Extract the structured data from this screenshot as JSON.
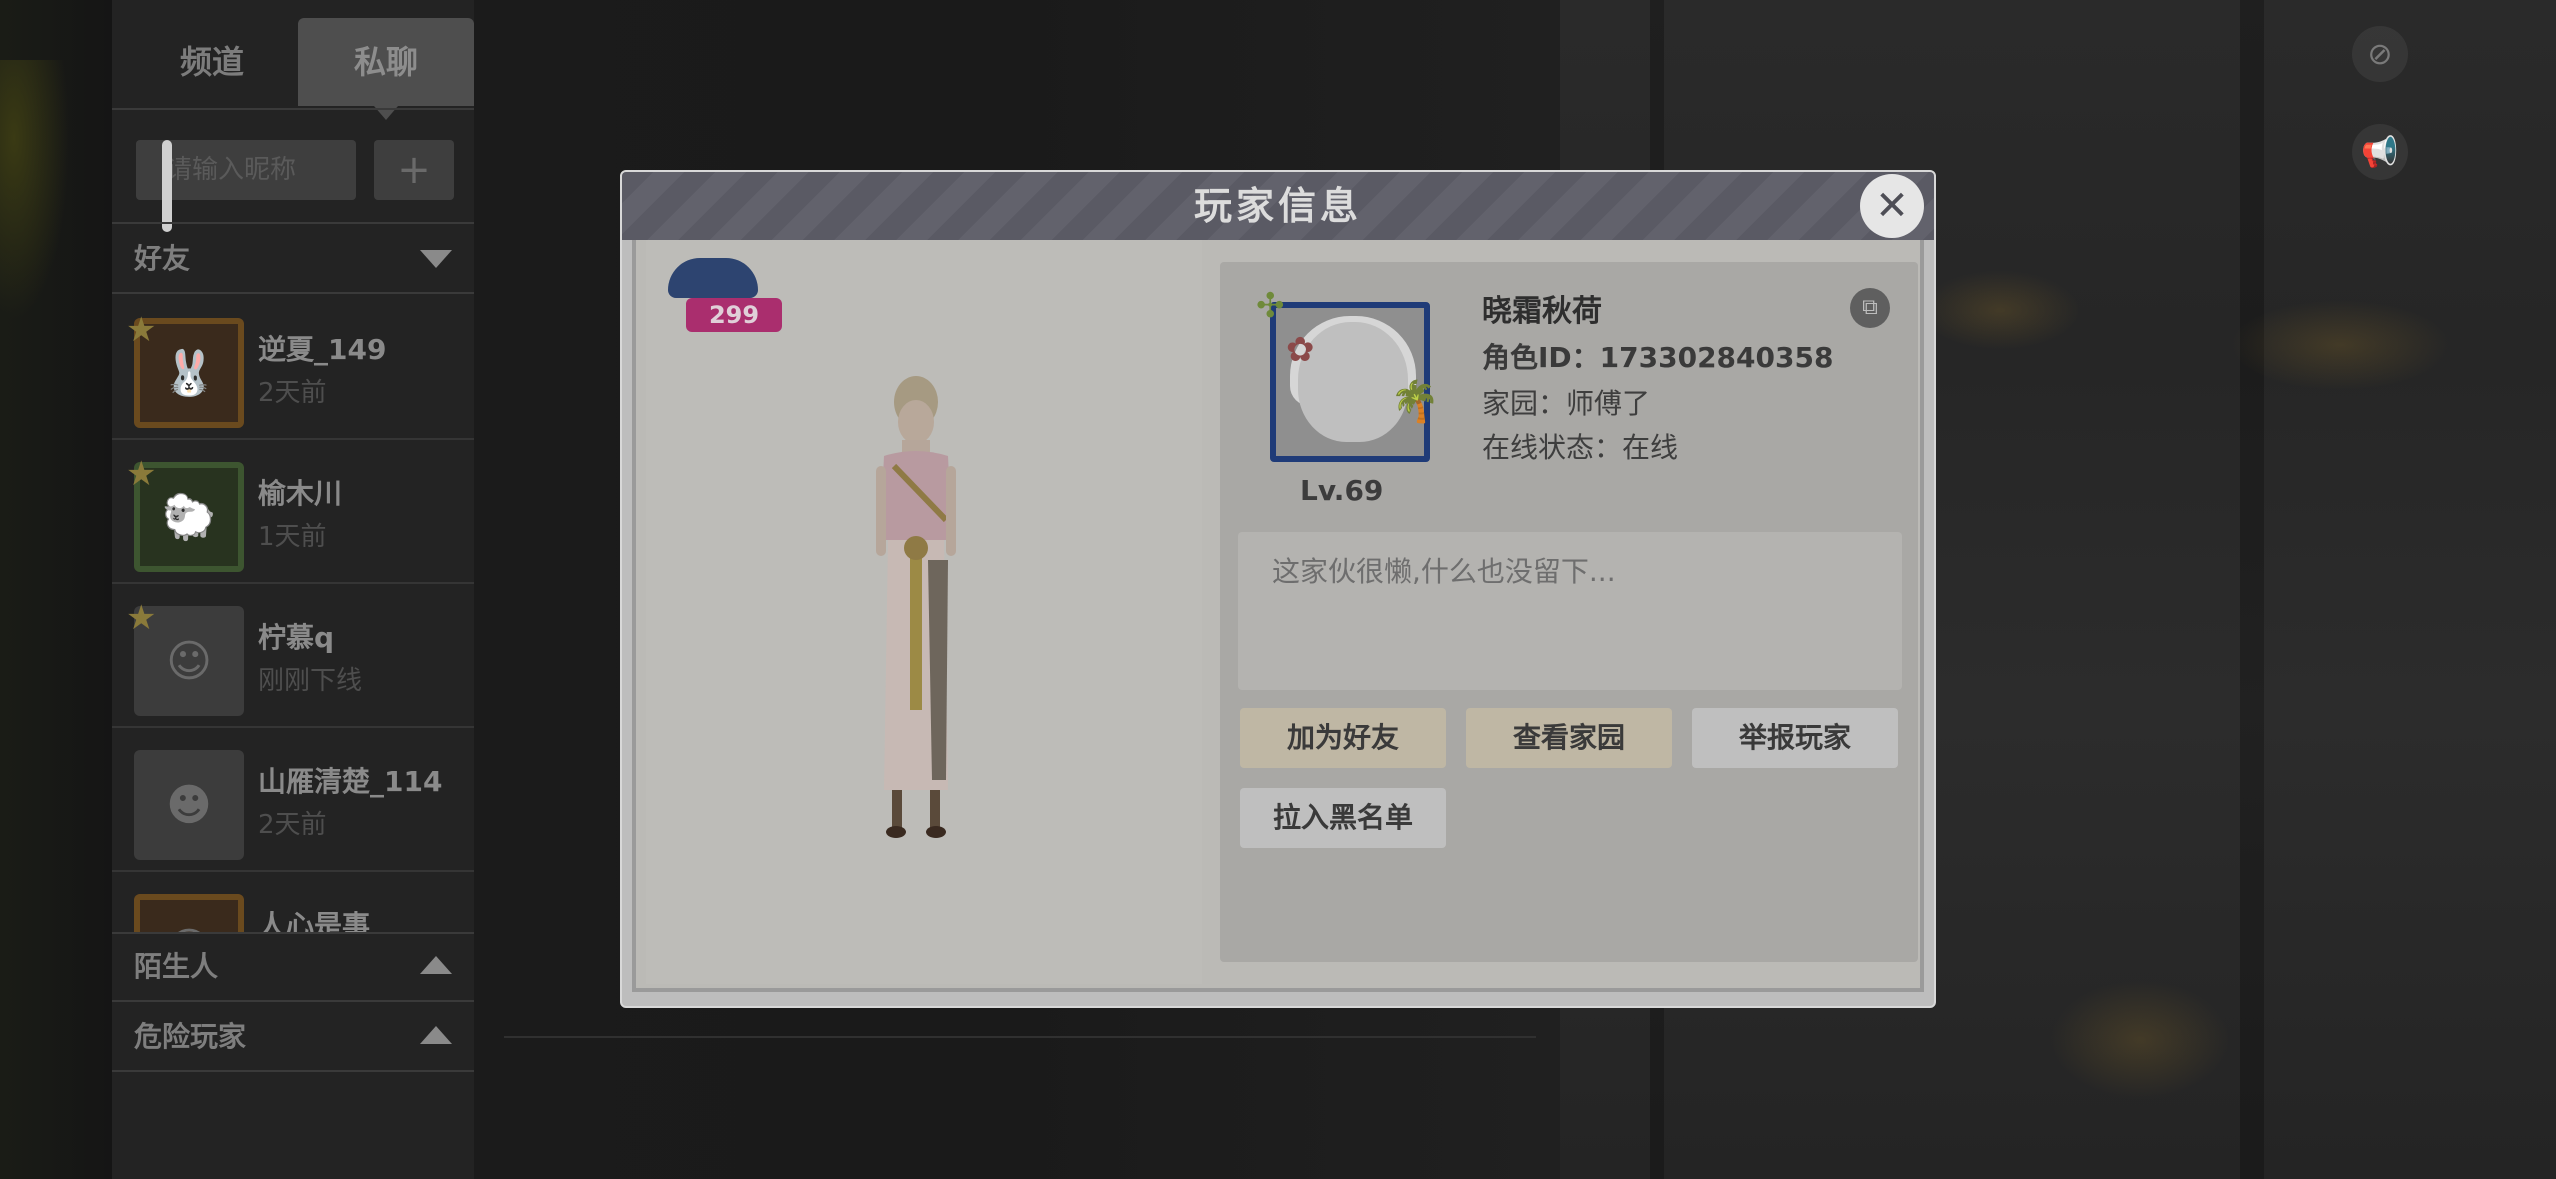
{
  "sidebar": {
    "tabs": [
      "频道",
      "私聊"
    ],
    "search_placeholder": "请输入昵称",
    "add_label": "+",
    "sections": {
      "friends": "好友",
      "strangers": "陌生人",
      "dangerous": "危险玩家"
    },
    "friends": [
      {
        "name": "逆夏_149",
        "time": "2天前"
      },
      {
        "name": "榆木川",
        "time": "1天前"
      },
      {
        "name": "柠慕q",
        "time": "刚刚下线"
      },
      {
        "name": "山雁清楚_114",
        "time": "2天前"
      },
      {
        "name": "人心是事",
        "time": ""
      }
    ]
  },
  "modal": {
    "title": "玩家信息",
    "close_icon": "close-icon",
    "badge_value": "299",
    "level": "Lv.69",
    "player_name": "晓霜秋荷",
    "role_id": "角色ID：17330284035​8",
    "home": "家园：师傅了",
    "online_status": "在线状态：在线",
    "bio": "这家伙很懒,什么也没留下...",
    "buttons": {
      "add_friend": "加为好友",
      "view_home": "查看家园",
      "report": "举报玩家",
      "block": "拉入黑名单"
    }
  },
  "colors": {
    "overlay": "#141414",
    "modal_header": "#5a5a64",
    "portrait_border": "#1f3b78",
    "badge": "#aa2e6e"
  }
}
